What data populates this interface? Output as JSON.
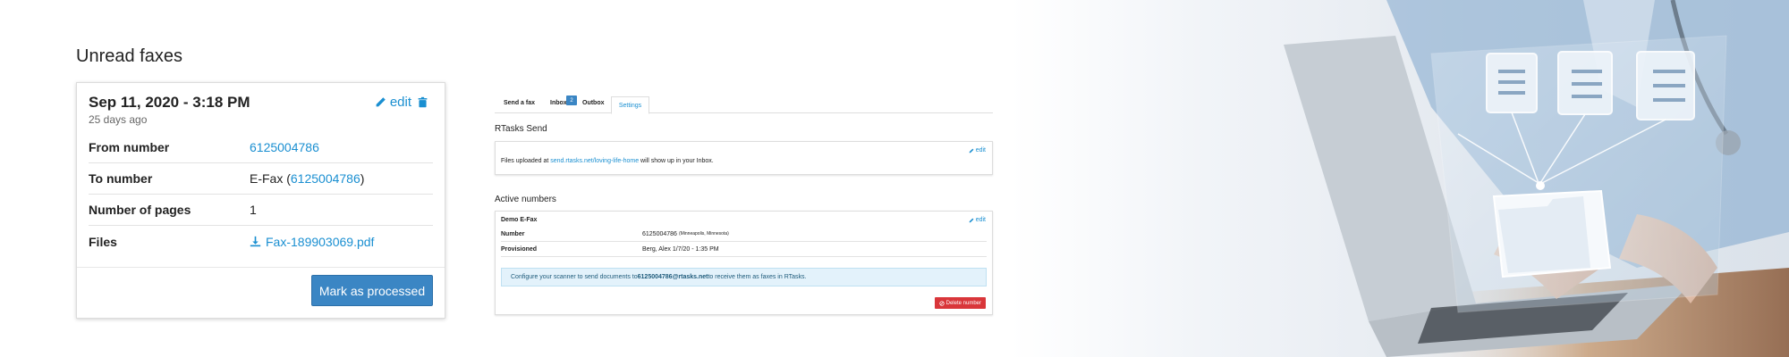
{
  "unread": {
    "title": "Unread faxes",
    "card": {
      "date": "Sep 11, 2020 - 3:18 PM",
      "ago": "25 days ago",
      "edit_label": "edit",
      "rows": {
        "from_label": "From number",
        "from_value": "6125004786",
        "to_label": "To number",
        "to_prefix": "E-Fax (",
        "to_value": "6125004786",
        "to_suffix": ")",
        "pages_label": "Number of pages",
        "pages_value": "1",
        "files_label": "Files",
        "files_value": "Fax-189903069.pdf"
      },
      "button_label": "Mark as processed"
    }
  },
  "settings_screenshot": {
    "tabs": [
      "Send a fax",
      "Inbox",
      "Outbox",
      "Settings"
    ],
    "inbox_badge": "2",
    "send_section": {
      "title": "RTasks Send",
      "edit_label": "edit",
      "text_before": "Files uploaded at ",
      "link": "send.rtasks.net/loving-life-home",
      "text_after": " will show up in your Inbox."
    },
    "active_section": {
      "title": "Active numbers",
      "card_title": "Demo E-Fax",
      "edit_label": "edit",
      "number_label": "Number",
      "number_value": "6125004786",
      "number_location": "(Minneapolis, Minnesota)",
      "provisioned_label": "Provisioned",
      "provisioned_value": "Berg, Alex 1/7/20 - 1:35 PM",
      "note_before": "Configure your scanner to send documents to ",
      "note_email": "6125004786@rtasks.net",
      "note_after": " to receive them as faxes in RTasks.",
      "delete_label": "Delete number"
    }
  },
  "colors": {
    "accent": "#1a8fd1",
    "primary_button": "#3b86c4",
    "danger": "#d9363a",
    "info_background": "#e3f2fb"
  },
  "icons": [
    "pencil-icon",
    "trash-icon",
    "download-icon",
    "ban-icon"
  ]
}
